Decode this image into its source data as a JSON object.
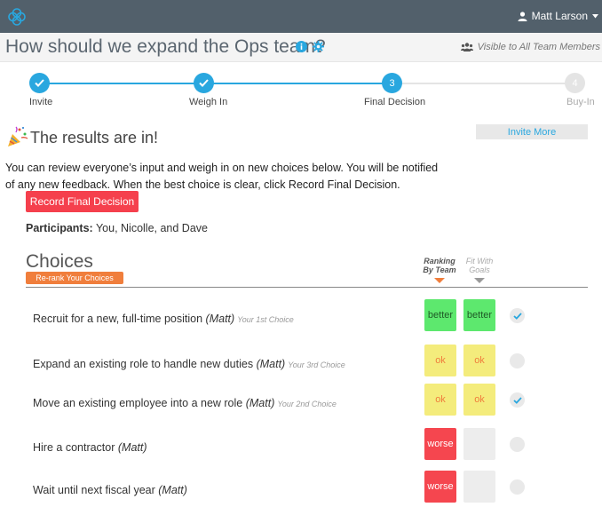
{
  "topbar": {
    "user_name": "Matt Larson",
    "user_icon": "person-icon",
    "caret_icon": "caret-down-icon",
    "logo_icon": "app-logo-icon"
  },
  "header": {
    "title": "How should we expand the Ops team?",
    "info_icon": "info-icon",
    "settings_icon": "gear-icon",
    "visibility_icon": "group-icon",
    "visibility_text": "Visible to All Team Members"
  },
  "steps": [
    {
      "label": "Invite",
      "state": "done",
      "marker": ""
    },
    {
      "label": "Weigh In",
      "state": "done",
      "marker": ""
    },
    {
      "label": "Final Decision",
      "state": "current",
      "marker": "3"
    },
    {
      "label": "Buy-In",
      "state": "upcoming",
      "marker": "4"
    }
  ],
  "results": {
    "title": "The results are in!",
    "icon": "party-popper-icon",
    "invite_label": "Invite More",
    "description": "You can review everyone’s input and weigh in on new choices below. You will be notified of any new feedback. When the best choice is clear, click Record Final Decision.",
    "record_label": "Record Final Decision",
    "participants_label": "Participants:",
    "participants_value": "You, Nicolle, and Dave"
  },
  "choices": {
    "heading": "Choices",
    "rerank_label": "Re-rank Your Choices",
    "col_ranking": "Ranking By Team",
    "col_fit": "Fit With Goals",
    "items": [
      {
        "text": "Recruit for a new, full-time position",
        "author": "(Matt)",
        "note": "Your 1st Choice",
        "ranking": "better",
        "fit": "better",
        "checked": true
      },
      {
        "text": "Expand an existing role to handle new duties",
        "author": "(Matt)",
        "note": "Your 3rd Choice",
        "ranking": "ok",
        "fit": "ok",
        "checked": false
      },
      {
        "text": "Move an existing employee into a new role",
        "author": "(Matt)",
        "note": "Your 2nd Choice",
        "ranking": "ok",
        "fit": "ok",
        "checked": true
      },
      {
        "text": "Hire a contractor",
        "author": "(Matt)",
        "note": "",
        "ranking": "worse",
        "fit": "",
        "checked": false
      },
      {
        "text": "Wait until next fiscal year",
        "author": "(Matt)",
        "note": "",
        "ranking": "worse",
        "fit": "",
        "checked": false
      }
    ]
  },
  "colors": {
    "better": "#5de86e",
    "ok": "#f4ec7c",
    "worse": "#f5464f",
    "empty": "#ededed",
    "accent": "#29a7df",
    "done": "#29a7df",
    "upcoming": "#e4e4e4",
    "orange": "#f07e3c"
  }
}
